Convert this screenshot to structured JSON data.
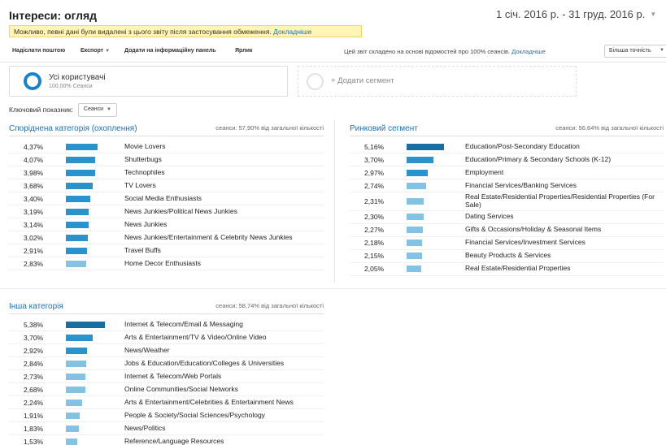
{
  "header": {
    "title": "Інтереси: огляд",
    "date_range": "1 січ. 2016 р. - 31 груд. 2016 р."
  },
  "notice": {
    "text": "Можливо, певні дані були видалені з цього звіту після застосування обмеження.",
    "link": "Докладніше"
  },
  "toolbar": {
    "email": "Надіслати поштою",
    "export": "Експорт",
    "dashboard": "Додати на інформаційну панель",
    "shortcut": "Ярлик",
    "basis_text": "Цей звіт складено на основі відомостей про 100% сеансів.",
    "basis_link": "Докладніше",
    "precision": "Більша точність"
  },
  "segments": {
    "all_users_name": "Усі користувачі",
    "all_users_sub": "100,00% Сеанси",
    "add_segment": "+ Додати сегмент"
  },
  "metric": {
    "label": "Ключовий показник:",
    "value": "Сеанси"
  },
  "colors": {
    "dark_bar": "#1a6fa0",
    "mid_bar": "#2b93cc",
    "light_bar": "#83c2e2",
    "link": "#1a6fbb"
  },
  "panels": {
    "affinity": {
      "title": "Споріднена категорія (охоплення)",
      "stat": "сеанси: 57,90% від загальної кількості",
      "rows": [
        {
          "pct": "4,37%",
          "value": 4.37,
          "label": "Movie Lovers"
        },
        {
          "pct": "4,07%",
          "value": 4.07,
          "label": "Shutterbugs"
        },
        {
          "pct": "3,98%",
          "value": 3.98,
          "label": "Technophiles"
        },
        {
          "pct": "3,68%",
          "value": 3.68,
          "label": "TV Lovers"
        },
        {
          "pct": "3,40%",
          "value": 3.4,
          "label": "Social Media Enthusiasts"
        },
        {
          "pct": "3,19%",
          "value": 3.19,
          "label": "News Junkies/Political News Junkies"
        },
        {
          "pct": "3,14%",
          "value": 3.14,
          "label": "News Junkies"
        },
        {
          "pct": "3,02%",
          "value": 3.02,
          "label": "News Junkies/Entertainment & Celebrity News Junkies"
        },
        {
          "pct": "2,91%",
          "value": 2.91,
          "label": "Travel Buffs"
        },
        {
          "pct": "2,83%",
          "value": 2.83,
          "label": "Home Decor Enthusiasts"
        }
      ]
    },
    "market": {
      "title": "Ринковий сегмент",
      "stat": "сеанси: 56,64% від загальної кількості",
      "rows": [
        {
          "pct": "5,16%",
          "value": 5.16,
          "label": "Education/Post-Secondary Education"
        },
        {
          "pct": "3,70%",
          "value": 3.7,
          "label": "Education/Primary & Secondary Schools (K-12)"
        },
        {
          "pct": "2,97%",
          "value": 2.97,
          "label": "Employment"
        },
        {
          "pct": "2,74%",
          "value": 2.74,
          "label": "Financial Services/Banking Services"
        },
        {
          "pct": "2,31%",
          "value": 2.31,
          "label": "Real Estate/Residential Properties/Residential Properties (For Sale)"
        },
        {
          "pct": "2,30%",
          "value": 2.3,
          "label": "Dating Services"
        },
        {
          "pct": "2,27%",
          "value": 2.27,
          "label": "Gifts & Occasions/Holiday & Seasonal Items"
        },
        {
          "pct": "2,18%",
          "value": 2.18,
          "label": "Financial Services/Investment Services"
        },
        {
          "pct": "2,15%",
          "value": 2.15,
          "label": "Beauty Products & Services"
        },
        {
          "pct": "2,05%",
          "value": 2.05,
          "label": "Real Estate/Residential Properties"
        }
      ]
    },
    "other": {
      "title": "Інша категорія",
      "stat": "сеанси: 58,74% від загальної кількості",
      "rows": [
        {
          "pct": "5,38%",
          "value": 5.38,
          "label": "Internet & Telecom/Email & Messaging"
        },
        {
          "pct": "3,70%",
          "value": 3.7,
          "label": "Arts & Entertainment/TV & Video/Online Video"
        },
        {
          "pct": "2,92%",
          "value": 2.92,
          "label": "News/Weather"
        },
        {
          "pct": "2,84%",
          "value": 2.84,
          "label": "Jobs & Education/Education/Colleges & Universities"
        },
        {
          "pct": "2,73%",
          "value": 2.73,
          "label": "Internet & Telecom/Web Portals"
        },
        {
          "pct": "2,68%",
          "value": 2.68,
          "label": "Online Communities/Social Networks"
        },
        {
          "pct": "2,24%",
          "value": 2.24,
          "label": "Arts & Entertainment/Celebrities & Entertainment News"
        },
        {
          "pct": "1,91%",
          "value": 1.91,
          "label": "People & Society/Social Sciences/Psychology"
        },
        {
          "pct": "1,83%",
          "value": 1.83,
          "label": "News/Politics"
        },
        {
          "pct": "1,53%",
          "value": 1.53,
          "label": "Reference/Language Resources"
        }
      ]
    }
  }
}
